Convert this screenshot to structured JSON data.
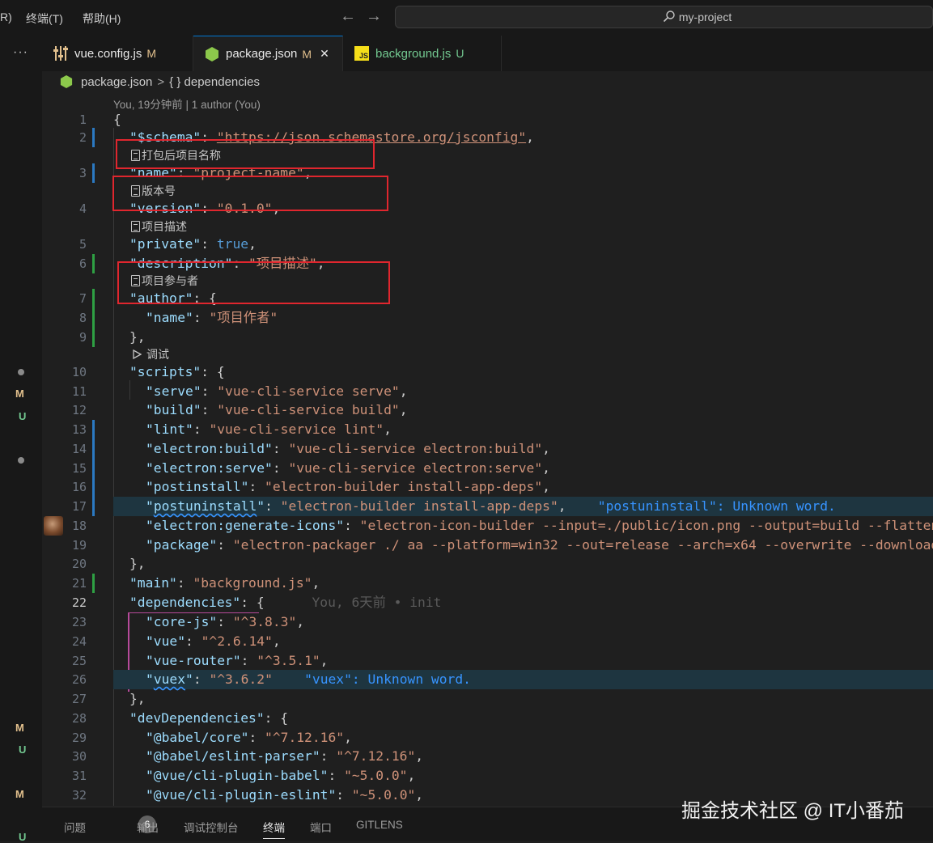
{
  "menu": {
    "partial": "R)",
    "terminal": "终端(T)",
    "help": "帮助(H)"
  },
  "search": {
    "text": "my-project"
  },
  "activity": {
    "more": "···",
    "marks": [
      "M",
      "U",
      "M",
      "U",
      "M",
      "U"
    ]
  },
  "tabs": [
    {
      "name": "vue.config.js",
      "status": "M",
      "icon": "settings-file-icon"
    },
    {
      "name": "package.json",
      "status": "M",
      "icon": "node-hexagon-icon",
      "close": "✕"
    },
    {
      "name": "background.js",
      "status": "U",
      "icon": "js-file-icon",
      "badge": "JS"
    }
  ],
  "breadcrumb": {
    "file": "package.json",
    "sep": ">",
    "symbol": "{ } dependencies"
  },
  "blame": "You, 19分钟前 | 1 author (You)",
  "lenses": {
    "pack_name": "打包后项目名称",
    "version": "版本号",
    "description": "项目描述",
    "contributors": "项目参与者",
    "debug": "调试"
  },
  "inline": {
    "blame22": "You, 6天前 • init",
    "diag17": "\"postuninstall\": Unknown word.",
    "diag26": "\"vuex\": Unknown word."
  },
  "code": {
    "l1": "{",
    "l2_key": "\"$schema\"",
    "l2_url": "\"https://json.schemastore.org/jsconfig\"",
    "l3_key": "\"name\"",
    "l3_val": "\"project-name\"",
    "l4_key": "\"version\"",
    "l4_val": "\"0.1.0\"",
    "l5_key": "\"private\"",
    "l5_val": "true",
    "l6_key": "\"description\"",
    "l6_val": "\"项目描述\"",
    "l7_key": "\"author\"",
    "l8_key": "\"name\"",
    "l8_val": "\"项目作者\"",
    "l10_key": "\"scripts\"",
    "l11_key": "\"serve\"",
    "l11_val": "\"vue-cli-service serve\"",
    "l12_key": "\"build\"",
    "l12_val": "\"vue-cli-service build\"",
    "l13_key": "\"lint\"",
    "l13_val": "\"vue-cli-service lint\"",
    "l14_key": "\"electron:build\"",
    "l14_val": "\"vue-cli-service electron:build\"",
    "l15_key": "\"electron:serve\"",
    "l15_val": "\"vue-cli-service electron:serve\"",
    "l16_key": "\"postinstall\"",
    "l16_val": "\"electron-builder install-app-deps\"",
    "l17_key": "postuninstall",
    "l17_val": "\"electron-builder install-app-deps\"",
    "l18_key": "\"electron:generate-icons\"",
    "l18_val": "\"electron-icon-builder --input=./public/icon.png --output=build --flatten\"",
    "l19_key": "\"package\"",
    "l19_val": "\"electron-packager ./ aa --platform=win32 --out=release --arch=x64 --overwrite --download.mirrorOptions.mirror=https://npm.taobao.org/mirrors/electron/\"",
    "l21_key": "\"main\"",
    "l21_val": "\"background.js\"",
    "l22_key": "\"dependencies\"",
    "l23_key": "\"core-js\"",
    "l23_val": "\"^3.8.3\"",
    "l24_key": "\"vue\"",
    "l24_val": "\"^2.6.14\"",
    "l25_key": "\"vue-router\"",
    "l25_val": "\"^3.5.1\"",
    "l26_key": "vuex",
    "l26_val": "\"^3.6.2\"",
    "l28_key": "\"devDependencies\"",
    "l29_key": "\"@babel/core\"",
    "l29_val": "\"^7.12.16\"",
    "l30_key": "\"@babel/eslint-parser\"",
    "l30_val": "\"^7.12.16\"",
    "l31_key": "\"@vue/cli-plugin-babel\"",
    "l31_val": "\"~5.0.0\"",
    "l32_key": "\"@vue/cli-plugin-eslint\"",
    "l32_val": "\"~5.0.0\""
  },
  "panel": {
    "problems": "问题",
    "problems_count": "6",
    "output": "输出",
    "debug_console": "调试控制台",
    "terminal": "终端",
    "ports": "端口",
    "gitlens": "GITLENS"
  },
  "watermark": "掘金技术社区 @ IT小番茄",
  "colors": {
    "accent": "#0078d4",
    "annotation_box": "#e0262e",
    "modified": "#e2c08d",
    "untracked": "#73c991"
  }
}
